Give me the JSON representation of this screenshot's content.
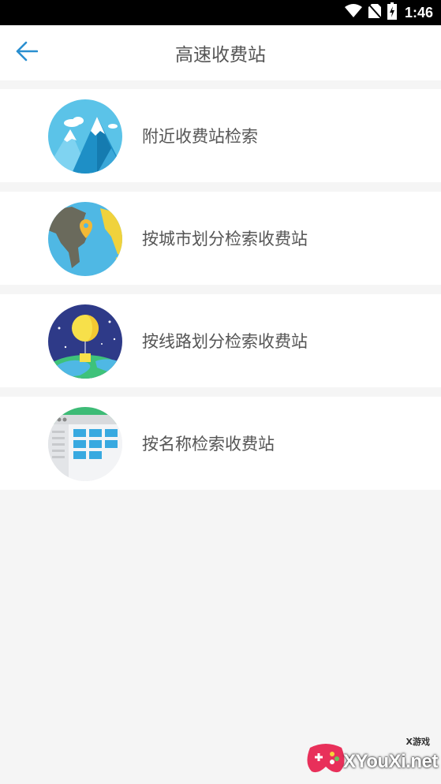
{
  "status_bar": {
    "time": "1:46",
    "icons": [
      "wifi-icon",
      "no-sim-icon",
      "battery-charging-icon"
    ]
  },
  "header": {
    "title": "高速收费站",
    "back_icon": "arrow-left-icon"
  },
  "colors": {
    "accent": "#2a8fd0",
    "background": "#f5f5f5",
    "text": "#555555"
  },
  "menu": [
    {
      "label": "附近收费站检索",
      "icon": "mountain-icon"
    },
    {
      "label": "按城市划分检索收费站",
      "icon": "globe-pin-icon"
    },
    {
      "label": "按线路划分检索收费站",
      "icon": "balloon-icon"
    },
    {
      "label": "按名称检索收费站",
      "icon": "table-grid-icon"
    }
  ],
  "watermark": {
    "small_text": "X游戏",
    "text": "XYouXi.net"
  }
}
